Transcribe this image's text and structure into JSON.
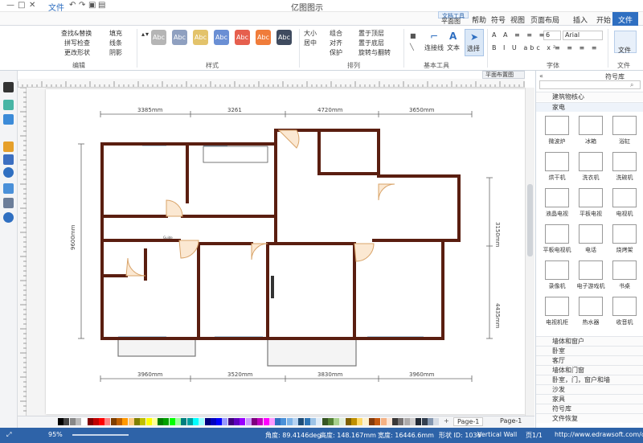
{
  "titlebar": {
    "title": "亿图图示",
    "qa": [
      "文件",
      "撤销",
      "重做",
      "保存",
      "打开"
    ],
    "controls": [
      "—",
      "□",
      "✕"
    ]
  },
  "tabs": [
    "文件",
    "开始",
    "插入",
    "页面布局",
    "视图",
    "符号",
    "帮助",
    "平面图"
  ],
  "tools_tab": "文档工具",
  "active_tab": "开始",
  "ribbon": {
    "groups": [
      "文件",
      "字体",
      "基本工具",
      "排列",
      "样式",
      "编辑"
    ],
    "font_name": "Arial",
    "font_size": "6",
    "tools": [
      "选择",
      "文本",
      "连接线"
    ],
    "arrange": [
      "置于顶层",
      "置于底层",
      "组合",
      "大小",
      "对齐",
      "旋转与翻转",
      "居中",
      "保护"
    ],
    "style_swatch_label": "Abc",
    "style_colors": [
      "#3f4b5f",
      "#f07c3a",
      "#e65f4e",
      "#6a8fd4",
      "#e3c36b",
      "#8fa0c0",
      "#b5b5b5"
    ],
    "edit": [
      "查找&替换",
      "拼写检查",
      "更改形状",
      "填充",
      "线条",
      "阴影"
    ]
  },
  "doc_tab": "平面布置图",
  "left_icons": [
    "format-icon",
    "page-icon",
    "layers-icon",
    "image-icon",
    "link-icon",
    "history-icon",
    "comment-icon",
    "help-icon"
  ],
  "floorplan": {
    "top_dims": [
      "3385mm",
      "3261",
      "4720mm",
      "3650mm"
    ],
    "bottom_dims": [
      "3960mm",
      "3520mm",
      "3830mm",
      "3960mm"
    ],
    "left_dim": "9600mm",
    "right_dims": [
      "3150mm",
      "4435mm"
    ],
    "label": "Guide"
  },
  "page_tabs": {
    "current": "Page-1",
    "add": "+",
    "name": "Page-1"
  },
  "right_panel": {
    "title": "符号库",
    "search_placeholder": "",
    "sections": [
      "建筑物核心",
      "家电"
    ],
    "items": [
      "浴缸",
      "冰箱",
      "微波炉",
      "洗碗机",
      "洗衣机",
      "烘干机",
      "电视机",
      "平板电视",
      "液晶电视",
      "烧烤架",
      "电话",
      "平板电视机",
      "书桌",
      "电子游戏机",
      "录像机",
      "收音机",
      "热水器",
      "电视机柜"
    ],
    "categories": [
      "墙体和窗户",
      "卧室",
      "客厅",
      "墙体和门窗",
      "卧室，门，窗户和墙",
      "沙发",
      "家具",
      "符号库",
      "文件恢复"
    ]
  },
  "statusbar": {
    "url": "http://www.edrawsoft.com/cn/",
    "page": "页1/1",
    "shape": "Vertical Wall",
    "id": "形状 ID: 1036",
    "width": "宽度: 16446.6mm",
    "height": "高度: 148.167mm",
    "angle": "角度: 89.4146deg",
    "zoom": "95%"
  }
}
